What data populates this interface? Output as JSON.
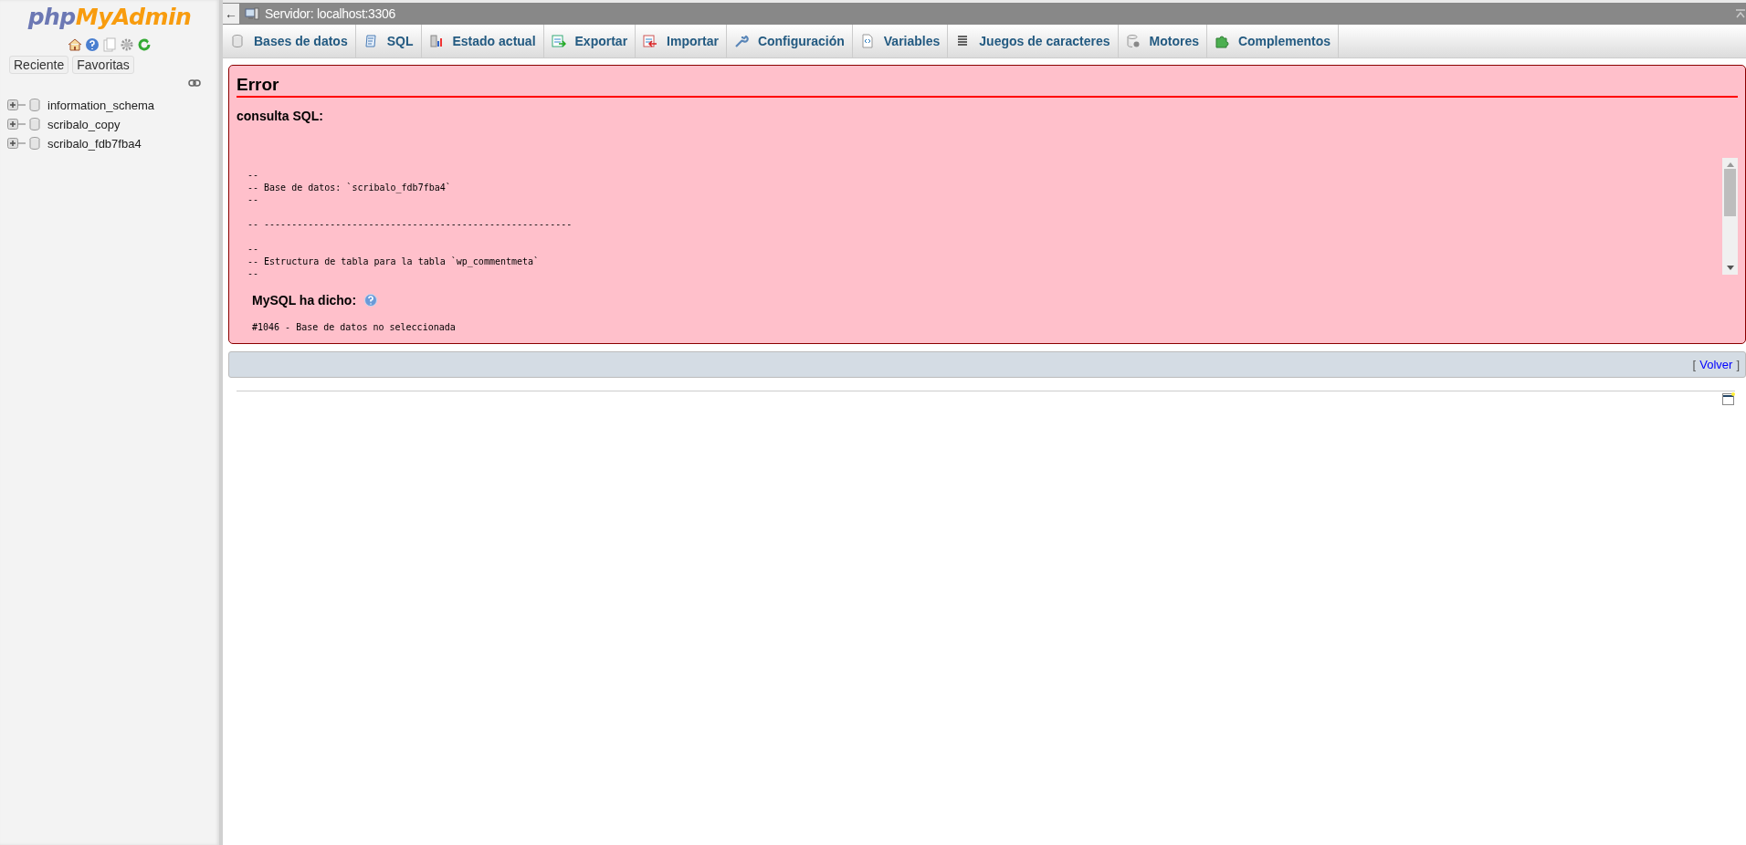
{
  "sidebar": {
    "logo": {
      "first": "php",
      "second": "MyAdmin"
    },
    "buttons": [
      {
        "label": "Reciente",
        "selected": false
      },
      {
        "label": "Favoritas",
        "selected": false
      }
    ],
    "databases": [
      {
        "name": "information_schema",
        "expanded": false
      },
      {
        "name": "scribalo_copy",
        "expanded": false
      },
      {
        "name": "scribalo_fdb7fba4",
        "expanded": false
      }
    ]
  },
  "top_bar": {
    "collapse": "←",
    "server": "Servidor: localhost:3306"
  },
  "tabs": [
    {
      "label": "Bases de datos",
      "selected": false
    },
    {
      "label": "SQL",
      "selected": false
    },
    {
      "label": "Estado actual",
      "selected": false
    },
    {
      "label": "Exportar",
      "selected": false
    },
    {
      "label": "Importar",
      "selected": false
    },
    {
      "label": "Configuración",
      "selected": false
    },
    {
      "label": "Variables",
      "selected": false
    },
    {
      "label": "Juegos de caracteres",
      "selected": false
    },
    {
      "label": "Motores",
      "selected": false
    },
    {
      "label": "Complementos",
      "selected": false
    }
  ],
  "error": {
    "title": "Error",
    "query_label": "consulta SQL:",
    "query": "--\n-- Base de datos: `scribalo_fdb7fba4`\n--\n\n-- --------------------------------------------------------\n\n--\n-- Estructura de tabla para la tabla `wp_commentmeta`\n--",
    "server_label": "MySQL ha dicho:",
    "message": "#1046 - Base de datos no seleccionada"
  },
  "back_link": {
    "open": "[",
    "label": "Volver",
    "close": "]"
  }
}
